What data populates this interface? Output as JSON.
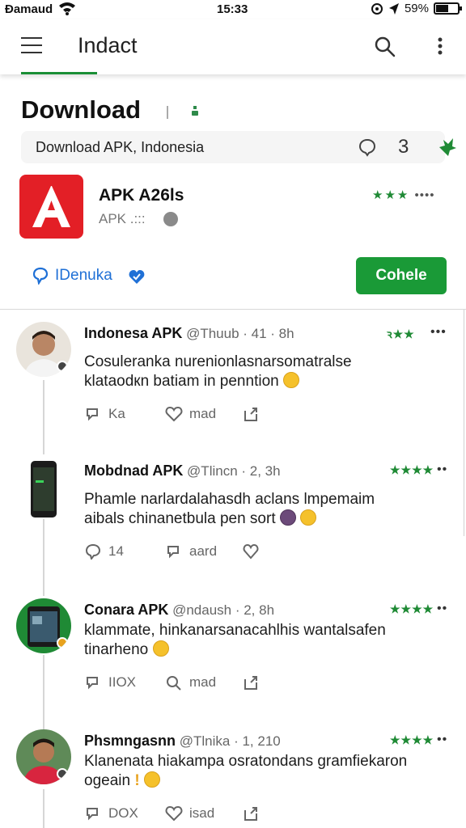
{
  "status_bar": {
    "carrier": "Ɖamaud",
    "time": "15:33",
    "battery": "59%",
    "battery_level": 0.59
  },
  "app_bar": {
    "title": "Indact"
  },
  "page": {
    "title": "Download",
    "search_query": "Download APK, Indonesia",
    "counter": "3"
  },
  "app": {
    "name": "APK A26ls",
    "subtitle": "APK .::: ",
    "rating_stars": "★★★",
    "rating_more": "••••",
    "follow_label": "IDenuka",
    "cta_label": "Cohele"
  },
  "posts": [
    {
      "name": "Indonesa APK",
      "meta": " @Thuub · 41 · 8h",
      "stars": "ꝛ★★",
      "more": "•••",
      "body": "Cosuleranka nurenionlasnarsomatralse klataodкn batiam in penntion",
      "actions": [
        "Ka",
        "mad",
        ""
      ]
    },
    {
      "name": "Mobdnad APK",
      "meta": " @Tlincn · 2, 3h",
      "stars": "★★★★",
      "more": "••",
      "body": "Phamle narlardalahasdh aclans lmpemaim aibals chinanetbula pen sort",
      "actions": [
        "14",
        "aard",
        ""
      ]
    },
    {
      "name": "Conara APK",
      "meta": " @ndaush · 2, 8h",
      "stars": "★★★★",
      "more": "••",
      "body": "klammate, hinkanarsanacahlhis wantalsafen tinarheno",
      "actions": [
        "IIOX",
        "mad",
        ""
      ]
    },
    {
      "name": "Phsmngasnn",
      "meta": " @Tlnika · 1, 210",
      "stars": "★★★★",
      "more": "••",
      "body": "Klanenata hiakampa osratondans gramfiekaron ogeain",
      "actions": [
        "DOX",
        "isad",
        ""
      ]
    }
  ],
  "colors": {
    "accent": "#1a9a37",
    "star": "#1f8a35",
    "link": "#1f70d6",
    "app_icon": "#e31f26"
  },
  "icons": [
    "menu-icon",
    "search-icon",
    "more-vert-icon",
    "heart-icon",
    "leaf-icon",
    "verified-icon",
    "reply-icon",
    "share-icon"
  ]
}
